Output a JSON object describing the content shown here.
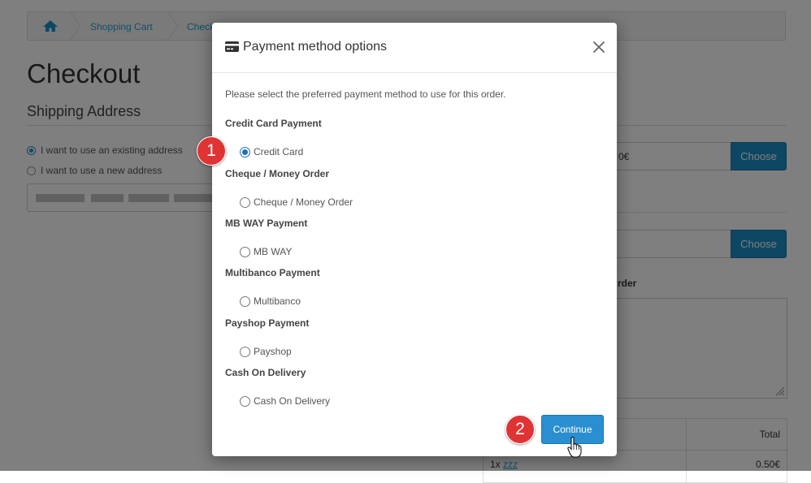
{
  "breadcrumb": {
    "items": [
      "Shopping Cart",
      "Checkout"
    ]
  },
  "page": {
    "title": "Checkout",
    "shipping_title": "Shipping Address",
    "address_options": [
      {
        "label": "I want to use an existing address",
        "selected": true
      },
      {
        "label": "I want to use a new address",
        "selected": false
      }
    ],
    "shipping_field_value": "0€",
    "choose_label": "Choose",
    "comment_label_fragment": "rder",
    "table": {
      "total_header": "Total",
      "item_qty": "1x",
      "item_link": "zzz",
      "item_price": "0.50€"
    }
  },
  "modal": {
    "title": "Payment method options",
    "intro": "Please select the preferred payment method to use for this order.",
    "groups": [
      {
        "label": "Credit Card Payment",
        "option": "Credit Card",
        "selected": true
      },
      {
        "label": "Cheque / Money Order",
        "option": "Cheque / Money Order",
        "selected": false
      },
      {
        "label": "MB WAY Payment",
        "option": "MB WAY",
        "selected": false
      },
      {
        "label": "Multibanco Payment",
        "option": "Multibanco",
        "selected": false
      },
      {
        "label": "Payshop Payment",
        "option": "Payshop",
        "selected": false
      },
      {
        "label": "Cash On Delivery",
        "option": "Cash On Delivery",
        "selected": false
      }
    ],
    "continue_label": "Continue"
  },
  "annotations": {
    "step1": "1",
    "step2": "2",
    "badge_color": "#e03434"
  },
  "colors": {
    "accent": "#2a8fd0",
    "link": "#23a1d1"
  }
}
